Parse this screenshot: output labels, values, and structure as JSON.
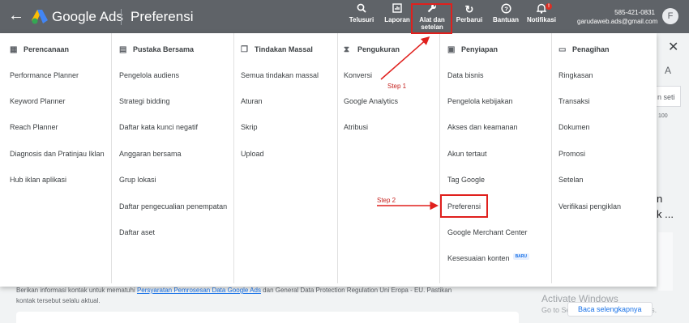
{
  "topbar": {
    "back_glyph": "←",
    "brand": "Google Ads",
    "page_title": "Preferensi",
    "buttons": [
      {
        "icon": "search-icon",
        "glyph": "🔍",
        "label": "Telusuri"
      },
      {
        "icon": "chart-icon",
        "glyph": "📊",
        "label": "Laporan"
      },
      {
        "icon": "wrench-icon",
        "glyph": "🔧",
        "label1": "Alat dan",
        "label2": "setelan"
      },
      {
        "icon": "refresh-icon",
        "glyph": "↻",
        "label": "Perbarui"
      },
      {
        "icon": "help-icon",
        "glyph": "?",
        "label": "Bantuan"
      },
      {
        "icon": "bell-icon",
        "glyph": "🔔",
        "label": "Notifikasi",
        "badge": "!"
      }
    ],
    "account_id": "585-421-0831",
    "account_email": "garudaweb.ads@gmail.com",
    "avatar_letter": "F"
  },
  "menu": {
    "columns": [
      {
        "header": "Perencanaan",
        "icon": "calendar-icon",
        "glyph": "▦",
        "items": [
          "Performance Planner",
          "Keyword Planner",
          "Reach Planner",
          "Diagnosis dan Pratinjau Iklan",
          "Hub iklan aplikasi"
        ]
      },
      {
        "header": "Pustaka Bersama",
        "icon": "library-icon",
        "glyph": "▤",
        "items": [
          "Pengelola audiens",
          "Strategi bidding",
          "Daftar kata kunci negatif",
          "Anggaran bersama",
          "Grup lokasi",
          "Daftar pengecualian penempatan",
          "Daftar aset"
        ]
      },
      {
        "header": "Tindakan Massal",
        "icon": "copy-icon",
        "glyph": "❐",
        "items": [
          "Semua tindakan massal",
          "Aturan",
          "Skrip",
          "Upload"
        ]
      },
      {
        "header": "Pengukuran",
        "icon": "hourglass-icon",
        "glyph": "⧗",
        "items": [
          "Konversi",
          "Google Analytics",
          "Atribusi"
        ]
      },
      {
        "header": "Penyiapan",
        "icon": "settings-box-icon",
        "glyph": "▣",
        "items": [
          "Data bisnis",
          "Pengelola kebijakan",
          "Akses dan keamanan",
          "Akun tertaut",
          "Tag Google",
          "Preferensi",
          "Google Merchant Center",
          "Kesesuaian konten"
        ],
        "new_badge": "BARU"
      },
      {
        "header": "Penagihan",
        "icon": "card-icon",
        "glyph": "▭",
        "items": [
          "Ringkasan",
          "Transaksi",
          "Dokumen",
          "Promosi",
          "Setelan",
          "Verifikasi pengiklan"
        ]
      }
    ]
  },
  "annotations": {
    "step1": "Step 1",
    "step2": "Step 2"
  },
  "background": {
    "close_glyph": "✕",
    "frag1": "n",
    "frag2": "k ...",
    "frag_input": "n seti",
    "frag_count": "100",
    "frag_letter": "A",
    "info_prefix": "Berikan informasi kontak untuk mematuhi ",
    "info_link": "Persyaratan Pemrosesan Data Google Ads",
    "info_suffix": " dan General Data Protection Regulation Uni Eropa - EU. Pastikan",
    "info_line2": "kontak tersebut selalu aktual.",
    "activate_title": "Activate Windows",
    "activate_sub": "Go to Settings to activate Windows.",
    "more_link": "Baca selengkapnya"
  }
}
